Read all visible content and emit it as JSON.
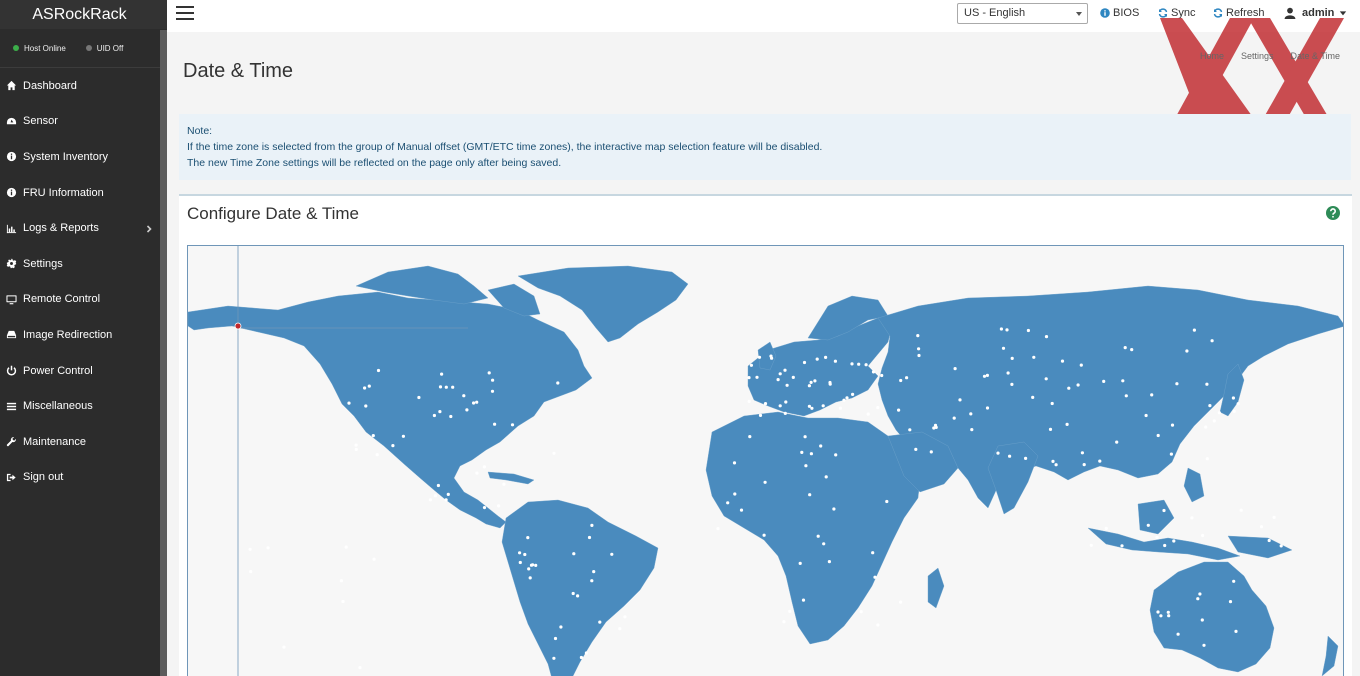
{
  "brand": "ASRockRack",
  "status": {
    "host": "Host Online",
    "uid": "UID Off",
    "host_color": "#3cae4a",
    "uid_color": "#777777"
  },
  "nav": [
    {
      "label": "Dashboard",
      "icon": "home-icon"
    },
    {
      "label": "Sensor",
      "icon": "gauge-icon"
    },
    {
      "label": "System Inventory",
      "icon": "info-icon"
    },
    {
      "label": "FRU Information",
      "icon": "info-icon"
    },
    {
      "label": "Logs & Reports",
      "icon": "bar-chart-icon"
    },
    {
      "label": "Settings",
      "icon": "gear-icon"
    },
    {
      "label": "Remote Control",
      "icon": "monitor-icon"
    },
    {
      "label": "Image Redirection",
      "icon": "drive-icon"
    },
    {
      "label": "Power Control",
      "icon": "power-icon"
    },
    {
      "label": "Miscellaneous",
      "icon": "list-icon"
    },
    {
      "label": "Maintenance",
      "icon": "wrench-icon"
    },
    {
      "label": "Sign out",
      "icon": "sign-out-icon"
    }
  ],
  "topbar": {
    "language": "US - English",
    "bios": "BIOS",
    "sync": "Sync",
    "refresh": "Refresh",
    "user": "admin"
  },
  "page": {
    "title": "Date & Time",
    "breadcrumb": [
      "Home",
      "Settings",
      "Date & Time"
    ]
  },
  "note": {
    "heading": "Note:",
    "line1": "If the time zone is selected from the group of Manual offset (GMT/ETC time zones), the interactive map selection feature will be disabled.",
    "line2": "The new Time Zone settings will be reflected on the page only after being saved."
  },
  "panel": {
    "title": "Configure Date & Time"
  },
  "colors": {
    "sidebar": "#2c2c2c",
    "map_land": "#4a8bbe",
    "watermark": "#c0282d"
  }
}
